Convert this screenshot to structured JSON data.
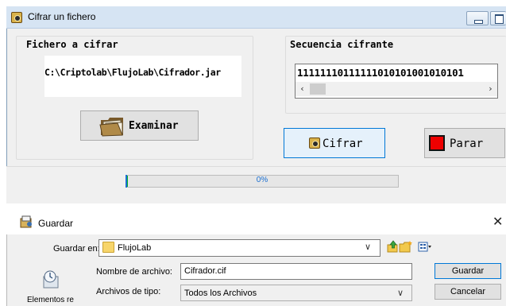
{
  "cipher_window": {
    "title": "Cifrar un fichero",
    "file_group": {
      "label": "Fichero a cifrar",
      "path": "C:\\Criptolab\\FlujoLab\\Cifrador.jar",
      "browse_button": "Examinar"
    },
    "sequence_group": {
      "label": "Secuencia cifrante",
      "value": "11111110111111010101001010101"
    },
    "cipher_button": "Cifrar",
    "stop_button": "Parar",
    "progress": {
      "percent": 0,
      "label": "0%"
    },
    "icons": {
      "window": "app-key-icon",
      "browse": "folder-files-icon",
      "cipher": "app-key-icon",
      "stop": "red-square-stop-icon"
    },
    "colors": {
      "titlebar": "#d6e4f3",
      "progress_text": "#1a6fd1",
      "stop_square": "#ee0000",
      "cipher_button_border": "#0078d7"
    }
  },
  "save_dialog": {
    "title": "Guardar",
    "save_in_label": "Guardar en:",
    "save_in_value": "FlujoLab",
    "filename_label": "Nombre de archivo:",
    "filename_value": "Cifrador.cif",
    "filetype_label": "Archivos de tipo:",
    "filetype_value": "Todos los Archivos",
    "save_button": "Guardar",
    "cancel_button": "Cancelar",
    "places_item": "Elementos re",
    "close_glyph": "✕",
    "icons": [
      "up-folder-icon",
      "new-folder-icon",
      "view-menu-icon",
      "recent-items-icon",
      "chevron-down-icon"
    ]
  }
}
